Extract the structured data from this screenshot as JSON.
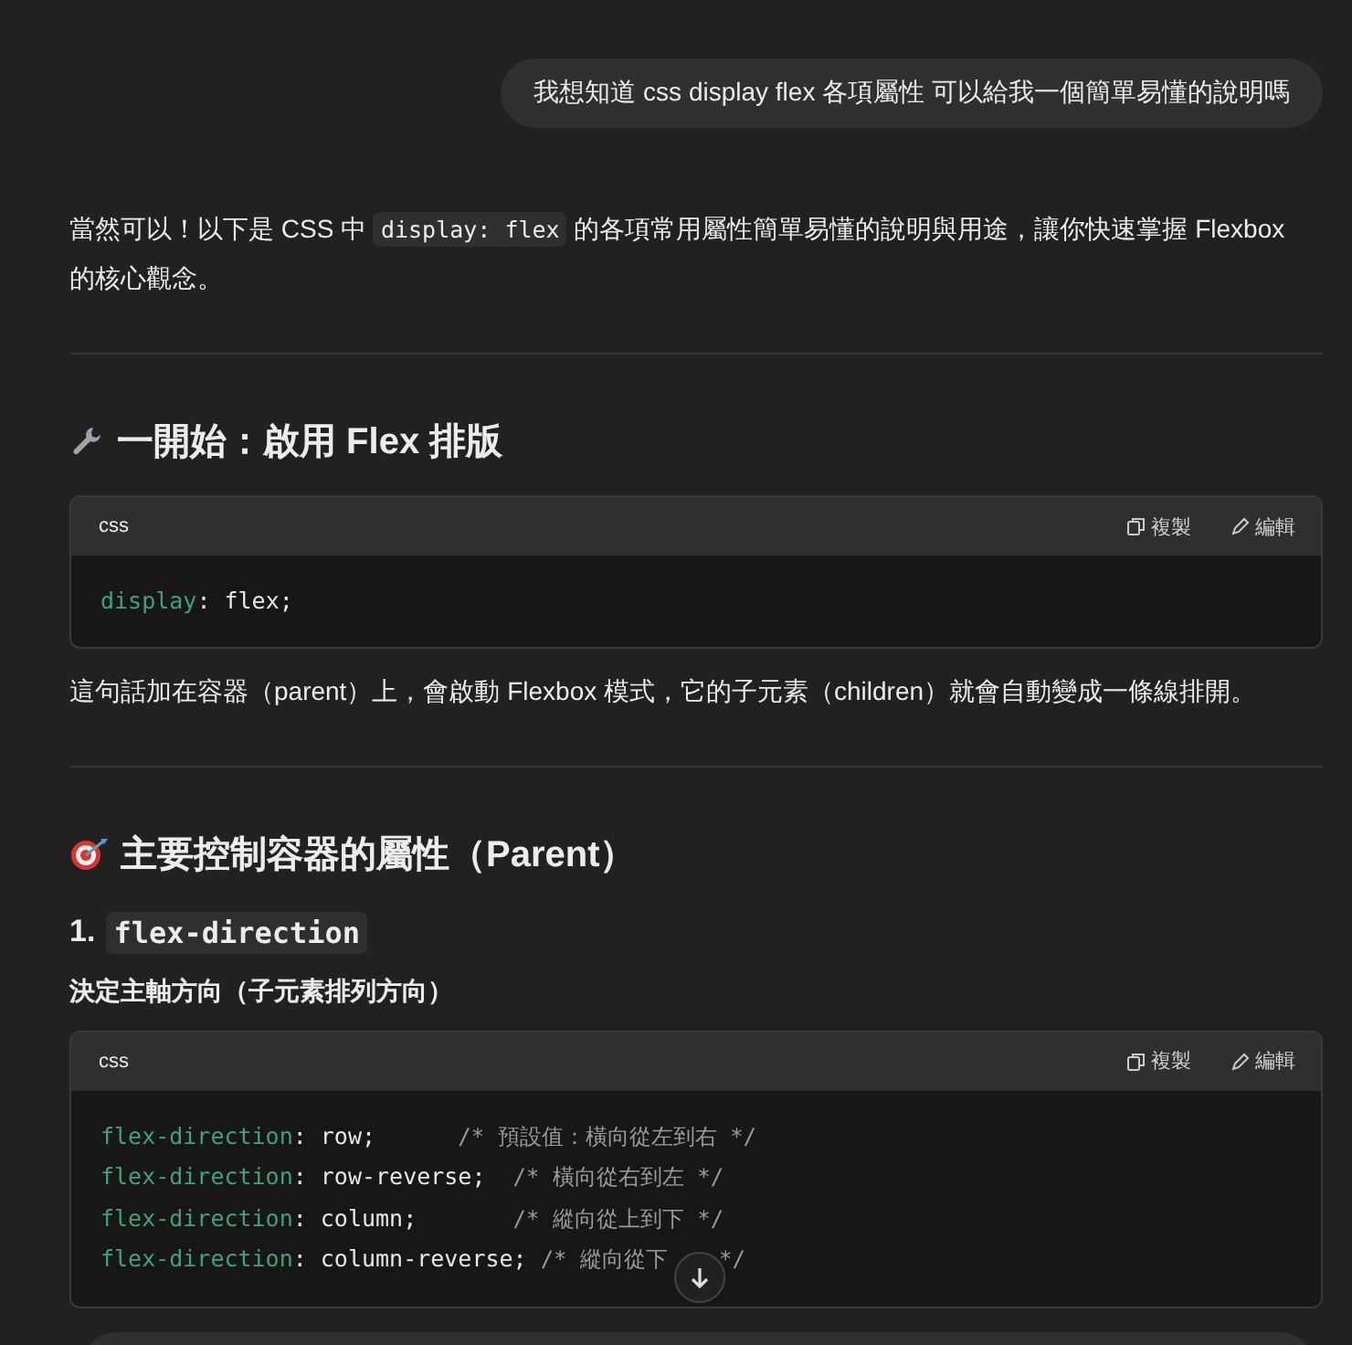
{
  "user_message": "我想知道 css display flex 各項屬性 可以給我一個簡單易懂的說明嗎",
  "intro": {
    "before": "當然可以！以下是 CSS 中 ",
    "code": "display: flex",
    "after": " 的各項常用屬性簡單易懂的說明與用途，讓你快速掌握 Flexbox 的核心觀念。"
  },
  "sections": [
    {
      "heading": "一開始：啟用 Flex 排版",
      "blocks": [
        {
          "kind": "code",
          "language": "css",
          "copy": "複製",
          "edit": "編輯",
          "lines": [
            {
              "prop": "display",
              "value": ": flex;"
            }
          ]
        },
        {
          "kind": "paragraph",
          "text": "這句話加在容器（parent）上，會啟動 Flexbox 模式，它的子元素（children）就會自動變成一條線排開。"
        }
      ]
    },
    {
      "heading": "主要控制容器的屬性（Parent）",
      "blocks": [
        {
          "kind": "subheading",
          "number": "1.",
          "code": "flex-direction"
        },
        {
          "kind": "label",
          "text": "決定主軸方向（子元素排列方向）"
        },
        {
          "kind": "code",
          "language": "css",
          "copy": "複製",
          "edit": "編輯",
          "lines": [
            {
              "prop": "flex-direction",
              "value": ": row;      ",
              "comment": "/* 預設值：橫向從左到右 */"
            },
            {
              "prop": "flex-direction",
              "value": ": row-reverse;  ",
              "comment": "/* 橫向從右到左 */"
            },
            {
              "prop": "flex-direction",
              "value": ": column;       ",
              "comment": "/* 縱向從上到下 */"
            },
            {
              "prop": "flex-direction",
              "value": ": column-reverse; ",
              "comment": "/* 縱向從下",
              "comment_end": "*/"
            }
          ]
        }
      ]
    }
  ]
}
